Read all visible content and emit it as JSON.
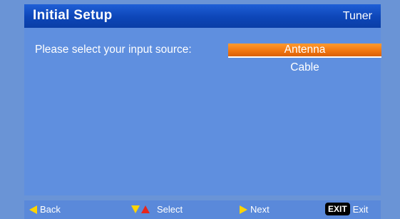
{
  "header": {
    "title": "Initial Setup",
    "section": "Tuner"
  },
  "main": {
    "prompt": "Please select your input source:",
    "options": [
      {
        "label": "Antenna",
        "selected": true
      },
      {
        "label": "Cable",
        "selected": false
      }
    ]
  },
  "footer": {
    "back": {
      "icon": "left-arrow-icon",
      "label": "Back"
    },
    "select": {
      "icon": "up-down-arrows-icon",
      "label": "Select"
    },
    "next": {
      "icon": "right-arrow-icon",
      "label": "Next"
    },
    "exit": {
      "key": "EXIT",
      "label": "Exit"
    }
  },
  "colors": {
    "header": "#0d46b8",
    "panel": "#5f8fdf",
    "selected": "#f0750f",
    "arrow": "#ffd400",
    "arrow_up": "#e8261b"
  }
}
